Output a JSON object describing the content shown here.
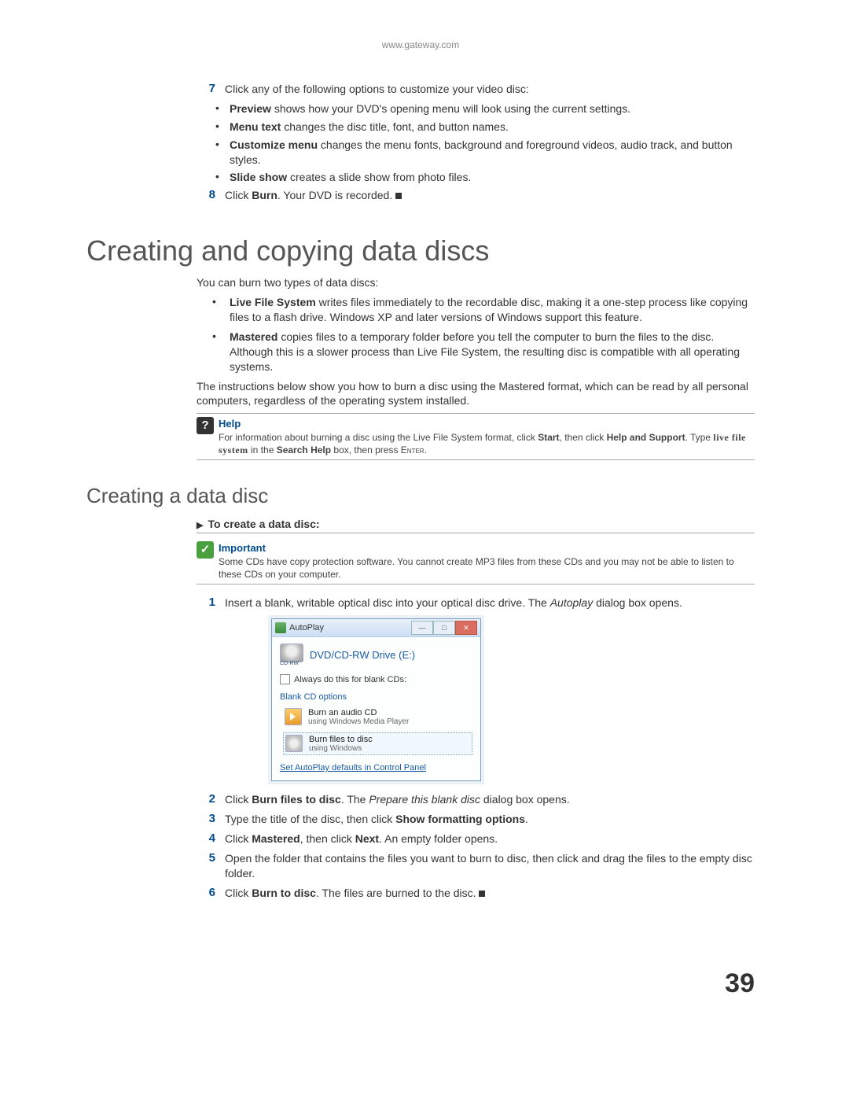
{
  "header_url": "www.gateway.com",
  "page_number": "39",
  "step7": {
    "num": "7",
    "intro": "Click any of the following options to customize your video disc:",
    "items": [
      {
        "b": "Preview",
        "t": " shows how your DVD's opening menu will look using the current settings."
      },
      {
        "b": "Menu text",
        "t": " changes the disc title, font, and button names."
      },
      {
        "b": "Customize menu",
        "t": " changes the menu fonts, background and foreground videos, audio track, and button styles."
      },
      {
        "b": "Slide show",
        "t": " creates a slide show from photo files."
      }
    ]
  },
  "step8": {
    "num": "8",
    "pre": "Click ",
    "b": "Burn",
    "post": ". Your DVD is recorded."
  },
  "h1": "Creating and copying data discs",
  "intro1": "You can burn two types of data discs:",
  "types": [
    {
      "b": "Live File System",
      "t": " writes files immediately to the recordable disc, making it a one-step process like copying files to a flash drive. Windows XP and later versions of Windows support this feature."
    },
    {
      "b": "Mastered",
      "t": " copies files to a temporary folder before you tell the computer to burn the files to the disc. Although this is a slower process than Live File System, the resulting disc is compatible with all operating systems."
    }
  ],
  "intro2": "The instructions below show you how to burn a disc using the Mastered format, which can be read by all personal computers, regardless of the operating system installed.",
  "help": {
    "title": "Help",
    "t1": "For information about burning a disc using the Live File System format, click ",
    "b1": "Start",
    "t2": ", then click ",
    "b2": "Help and Support",
    "t3": ". Type ",
    "m": "live file system",
    "t4": " in the ",
    "b3": "Search Help",
    "t5": " box, then press ",
    "sc": "Enter",
    "t6": "."
  },
  "h2": "Creating a data disc",
  "proc_title": "To create a data disc:",
  "important": {
    "title": "Important",
    "text": "Some CDs have copy protection software. You cannot create MP3 files from these CDs and you may not be able to listen to these CDs on your computer."
  },
  "autoplay": {
    "title": "AutoPlay",
    "drive": "DVD/CD-RW Drive (E:)",
    "cdrw": "CD-RW",
    "checkbox": "Always do this for blank CDs:",
    "section": "Blank CD options",
    "opt1_t": "Burn an audio CD",
    "opt1_s": "using Windows Media Player",
    "opt2_t": "Burn files to disc",
    "opt2_s": "using Windows",
    "link": "Set AutoPlay defaults in Control Panel"
  },
  "steps": [
    {
      "n": "1",
      "pre": "Insert a blank, writable optical disc into your optical disc drive. The ",
      "i": "Autoplay",
      "post": " dialog box opens."
    },
    {
      "n": "2",
      "pre": "Click ",
      "b": "Burn files to disc",
      "mid": ". The ",
      "i": "Prepare this blank disc",
      "post": " dialog box opens."
    },
    {
      "n": "3",
      "pre": "Type the title of the disc, then click ",
      "b": "Show formatting options",
      "post": "."
    },
    {
      "n": "4",
      "pre": "Click ",
      "b": "Mastered",
      "mid": ", then click ",
      "b2": "Next",
      "post": ". An empty folder opens."
    },
    {
      "n": "5",
      "pre": "Open the folder that contains the files you want to burn to disc, then click and drag the files to the empty disc folder."
    },
    {
      "n": "6",
      "pre": "Click ",
      "b": "Burn to disc",
      "post": ". The files are burned to the disc."
    }
  ]
}
